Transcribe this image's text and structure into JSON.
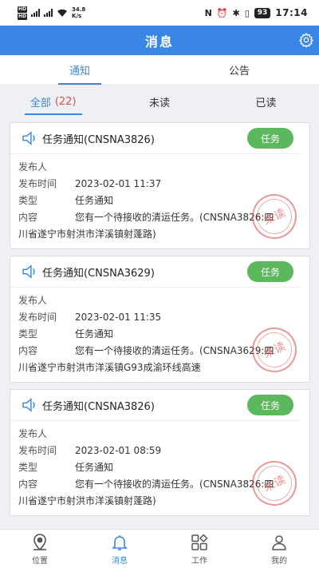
{
  "status_bar": {
    "speed_value": "34.8",
    "speed_unit": "K/s",
    "battery": "93",
    "time": "17:14"
  },
  "header": {
    "title": "消息"
  },
  "tabs": [
    {
      "label": "通知",
      "active": true
    },
    {
      "label": "公告",
      "active": false
    }
  ],
  "filters": [
    {
      "label": "全部",
      "count": "(22)",
      "active": true
    },
    {
      "label": "未读",
      "count": "",
      "active": false
    },
    {
      "label": "已读",
      "count": "",
      "active": false
    }
  ],
  "field_labels": {
    "publisher": "发布人",
    "publish_time": "发布时间",
    "type": "类型",
    "content": "内容"
  },
  "task_button_label": "任务",
  "stamp_text": "未读",
  "notices": [
    {
      "title": "任务通知(CNSNA3826)",
      "publisher": "",
      "publish_time": "2023-02-01 11:37",
      "type": "任务通知",
      "content_line1": "您有一个待接收的清运任务。(CNSNA3826:四",
      "content_line2": "川省遂宁市射洪市洋溪镇射蓬路)"
    },
    {
      "title": "任务通知(CNSNA3629)",
      "publisher": "",
      "publish_time": "2023-02-01 11:35",
      "type": "任务通知",
      "content_line1": "您有一个待接收的清运任务。(CNSNA3629:四",
      "content_line2": "川省遂宁市射洪市洋溪镇G93成渝环线高速"
    },
    {
      "title": "任务通知(CNSNA3826)",
      "publisher": "",
      "publish_time": "2023-02-01 08:59",
      "type": "任务通知",
      "content_line1": "您有一个待接收的清运任务。(CNSNA3826:四",
      "content_line2": "川省遂宁市射洪市洋溪镇射蓬路)"
    }
  ],
  "bottom_nav": [
    {
      "label": "位置",
      "icon": "location-pin-icon",
      "active": false
    },
    {
      "label": "消息",
      "icon": "bell-icon",
      "active": true
    },
    {
      "label": "工作",
      "icon": "grid-icon",
      "active": false
    },
    {
      "label": "我的",
      "icon": "person-icon",
      "active": false
    }
  ],
  "colors": {
    "primary": "#3a86e7",
    "task_button": "#5cb85c",
    "count": "#d9534f",
    "stamp": "#d74646"
  }
}
